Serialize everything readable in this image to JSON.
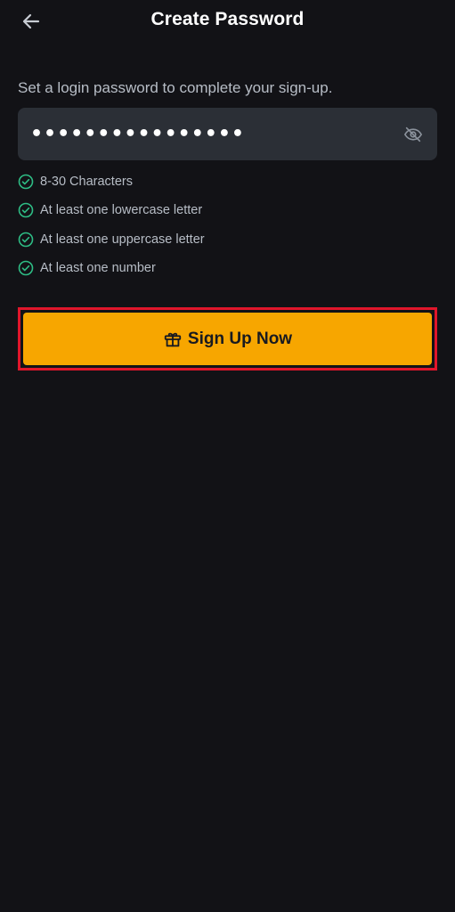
{
  "header": {
    "title": "Create Password",
    "back_icon": "arrow-left-icon"
  },
  "form": {
    "instruction": "Set a login password to complete your sign-up.",
    "password": {
      "value": "••••••••••••••••",
      "toggle_icon": "eye-off-icon"
    },
    "requirements": [
      {
        "label": "8-30 Characters",
        "met": true
      },
      {
        "label": "At least one lowercase letter",
        "met": true
      },
      {
        "label": "At least one uppercase letter",
        "met": true
      },
      {
        "label": "At least one number",
        "met": true
      }
    ],
    "submit": {
      "label": "Sign Up Now",
      "icon": "gift-icon"
    }
  },
  "colors": {
    "background": "#121216",
    "input_bg": "#2b2f36",
    "accent": "#f7a600",
    "check_green": "#2ebd85",
    "highlight_border": "#e0162b"
  }
}
